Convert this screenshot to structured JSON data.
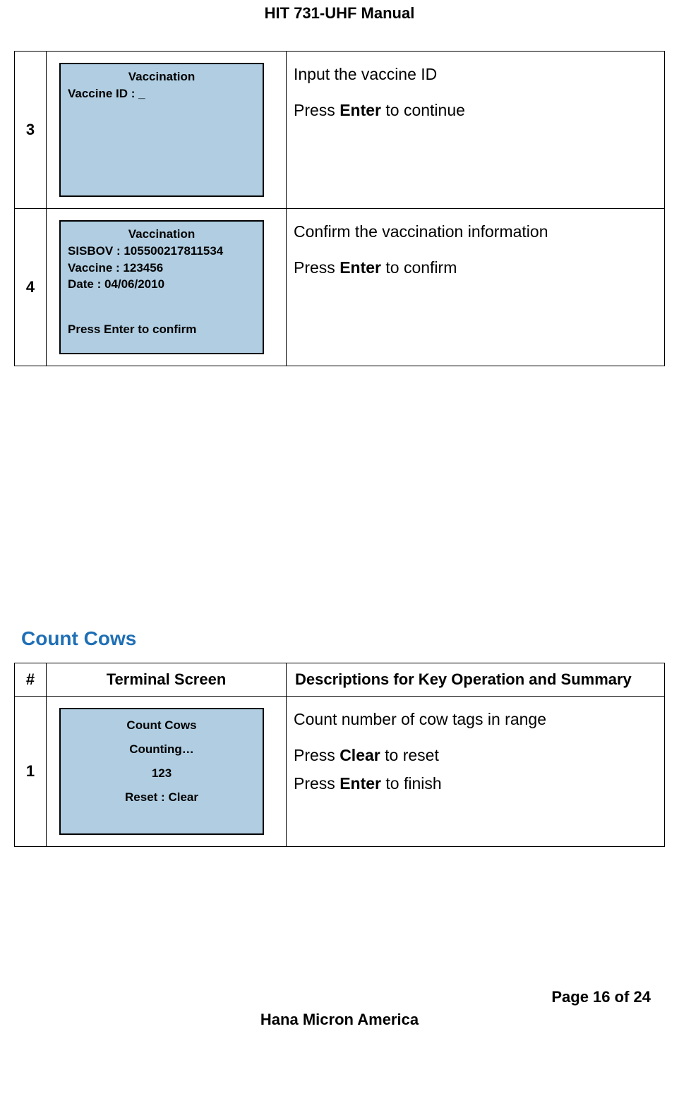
{
  "header": "HIT 731-UHF Manual",
  "table1": {
    "rows": [
      {
        "num": "3",
        "screen": {
          "title": "Vaccination",
          "lines": [
            "Vaccine ID : _"
          ]
        },
        "desc": {
          "line1": "Input the vaccine ID",
          "line2_pre": "Press ",
          "line2_bold": "Enter",
          "line2_post": " to continue"
        }
      },
      {
        "num": "4",
        "screen": {
          "title": "Vaccination",
          "lines": [
            "SISBOV : 105500217811534",
            "Vaccine : 123456",
            "Date : 04/06/2010"
          ],
          "footer": "Press Enter to confirm"
        },
        "desc": {
          "line1": "Confirm the vaccination information",
          "line2_pre": "Press ",
          "line2_bold": "Enter",
          "line2_post": " to confirm"
        }
      }
    ]
  },
  "section2_title": "Count Cows",
  "table2": {
    "headers": {
      "num": "#",
      "screen": "Terminal Screen",
      "desc": "Descriptions for Key Operation and Summary"
    },
    "row": {
      "num": "1",
      "screen": {
        "title": "Count Cows",
        "line1": "Counting…",
        "line2": "123",
        "footer": "Reset : Clear"
      },
      "desc": {
        "line1": "Count number of cow tags in range",
        "line2_pre": "Press ",
        "line2_bold": "Clear",
        "line2_post": " to reset",
        "line3_pre": "Press ",
        "line3_bold": "Enter",
        "line3_post": " to finish"
      }
    }
  },
  "footer": {
    "page": "Page 16 of 24",
    "company": "Hana Micron America"
  }
}
